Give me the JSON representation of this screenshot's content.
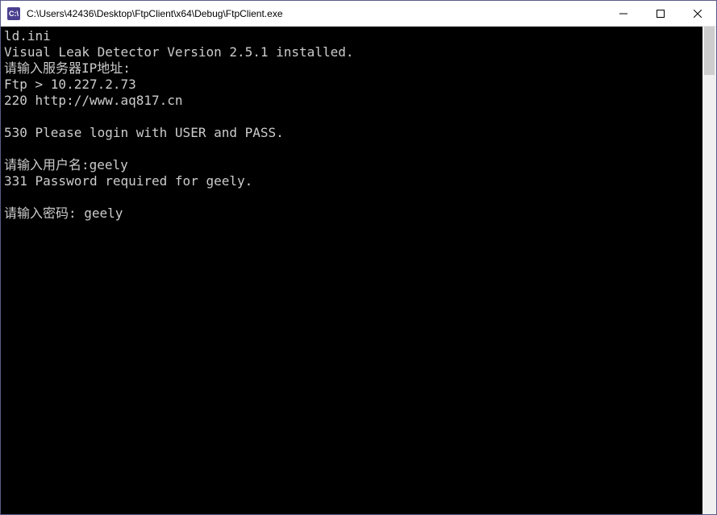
{
  "window": {
    "title": "C:\\Users\\42436\\Desktop\\FtpClient\\x64\\Debug\\FtpClient.exe",
    "icon_label": "C:\\"
  },
  "console": {
    "lines": [
      "ld.ini",
      "Visual Leak Detector Version 2.5.1 installed.",
      "请输入服务器IP地址:",
      "Ftp > 10.227.2.73",
      "220 http://www.aq817.cn",
      "",
      "530 Please login with USER and PASS.",
      "",
      "请输入用户名:geely",
      "331 Password required for geely.",
      "",
      "请输入密码: geely"
    ]
  }
}
